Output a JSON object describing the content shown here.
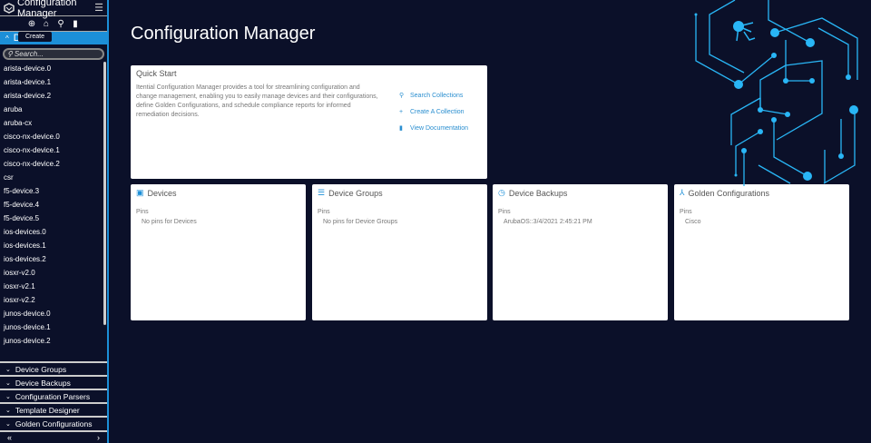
{
  "app": {
    "title": "Configuration Manager"
  },
  "sidebar": {
    "tooltip": "Create",
    "active_section": "D",
    "search_placeholder": "Search...",
    "devices": [
      "arista-device.0",
      "arista-device.1",
      "arista-device.2",
      "aruba",
      "aruba-cx",
      "cisco-nx-device.0",
      "cisco-nx-device.1",
      "cisco-nx-device.2",
      "csr",
      "f5-device.3",
      "f5-device.4",
      "f5-device.5",
      "ios-devices.0",
      "ios-devices.1",
      "ios-devices.2",
      "iosxr-v2.0",
      "iosxr-v2.1",
      "iosxr-v2.2",
      "junos-device.0",
      "junos-device.1",
      "junos-device.2"
    ],
    "sections": [
      "Device Groups",
      "Device Backups",
      "Configuration Parsers",
      "Template Designer",
      "Golden Configurations"
    ],
    "collapse": "«",
    "expand": "›"
  },
  "main": {
    "title": "Configuration Manager",
    "quick_start": {
      "title": "Quick Start",
      "text": "Itential Configuration Manager provides a tool for streamlining configuration and change management, enabling you to easily manage devices and their configurations, define Golden Configurations, and schedule compliance reports for informed remediation decisions.",
      "links": [
        "Search Collections",
        "Create A Collection",
        "View Documentation"
      ]
    },
    "cards": [
      {
        "title": "Devices",
        "pins_label": "Pins",
        "value": "No pins for Devices"
      },
      {
        "title": "Device Groups",
        "pins_label": "Pins",
        "value": "No pins for Device Groups"
      },
      {
        "title": "Device Backups",
        "pins_label": "Pins",
        "value": "ArubaOS::3/4/2021 2:45:21 PM"
      },
      {
        "title": "Golden Configurations",
        "pins_label": "Pins",
        "value": "Cisco"
      }
    ]
  },
  "colors": {
    "accent": "#1c8fd8",
    "background": "#0b1029",
    "circuit": "#29b6f6"
  }
}
